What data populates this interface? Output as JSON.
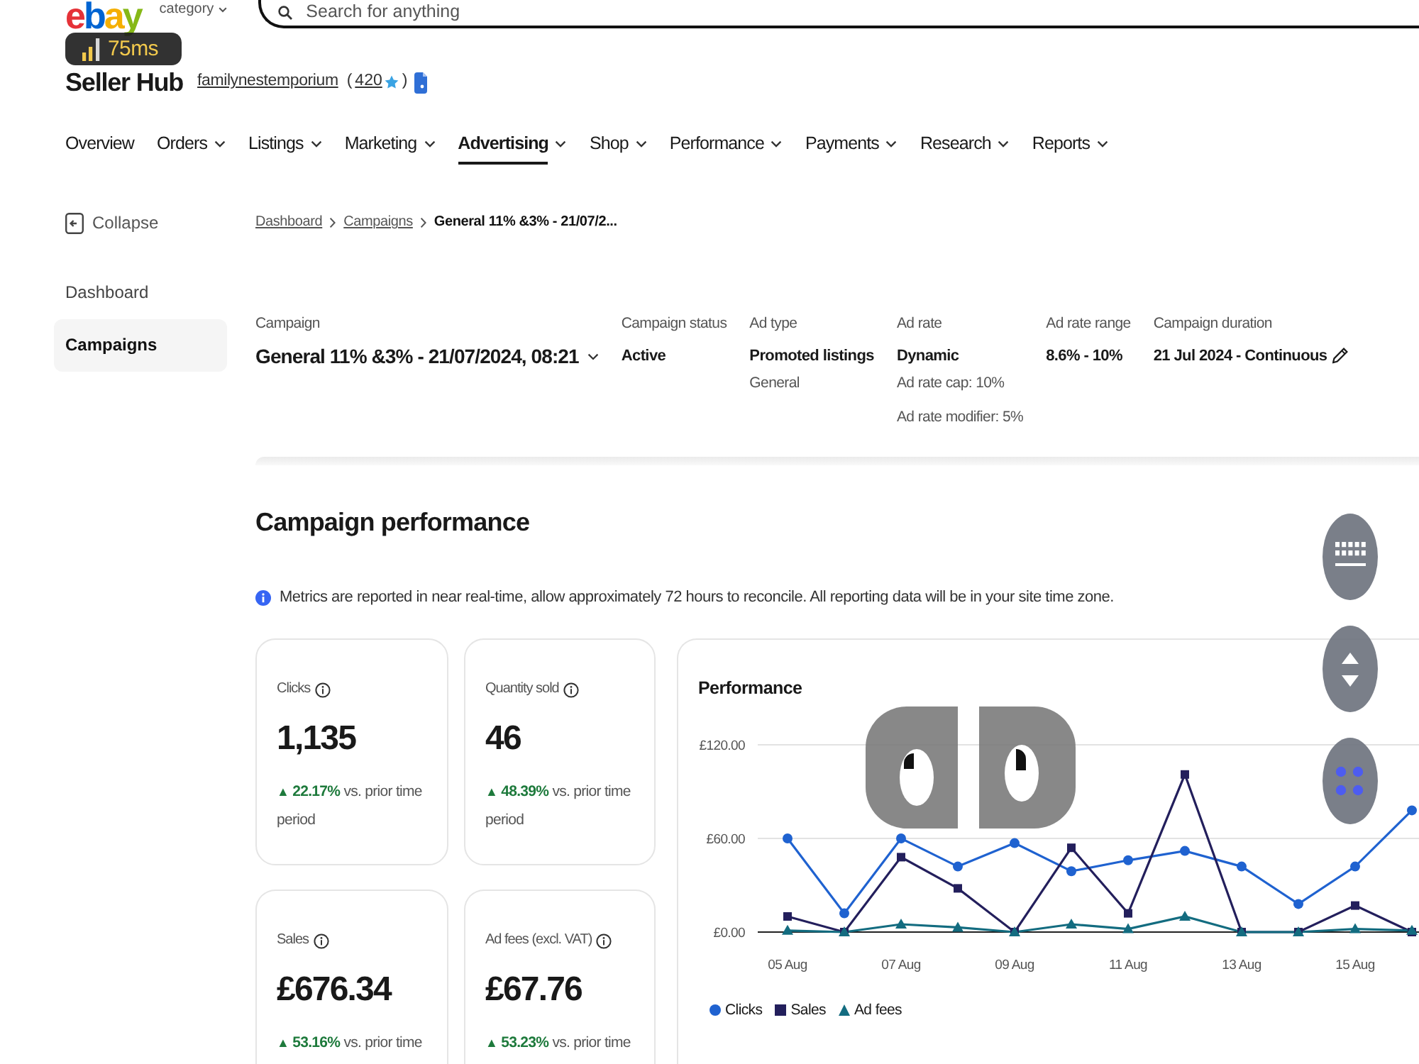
{
  "header": {
    "logo": "ebay",
    "category_label": "category",
    "search": {
      "placeholder": "Search for anything"
    }
  },
  "latency": {
    "reading": "75ms"
  },
  "seller": {
    "title": "Seller Hub",
    "name": "familynestemporium",
    "feedback_open": "(",
    "feedback_score": "420",
    "feedback_close": ")"
  },
  "nav": [
    {
      "label": "Overview",
      "dropdown": false,
      "selected": false
    },
    {
      "label": "Orders",
      "dropdown": true,
      "selected": false
    },
    {
      "label": "Listings",
      "dropdown": true,
      "selected": false
    },
    {
      "label": "Marketing",
      "dropdown": true,
      "selected": false
    },
    {
      "label": "Advertising",
      "dropdown": true,
      "selected": true
    },
    {
      "label": "Shop",
      "dropdown": true,
      "selected": false
    },
    {
      "label": "Performance",
      "dropdown": true,
      "selected": false
    },
    {
      "label": "Payments",
      "dropdown": true,
      "selected": false
    },
    {
      "label": "Research",
      "dropdown": true,
      "selected": false
    },
    {
      "label": "Reports",
      "dropdown": true,
      "selected": false
    }
  ],
  "sidebar": {
    "collapse": "Collapse",
    "items": [
      {
        "label": "Dashboard",
        "selected": false
      },
      {
        "label": "Campaigns",
        "selected": true
      }
    ]
  },
  "breadcrumb": [
    {
      "label": "Dashboard",
      "current": false
    },
    {
      "label": "Campaigns",
      "current": false
    },
    {
      "label": "General 11% &3% - 21/07/2...",
      "current": true
    }
  ],
  "campaign_fields": [
    {
      "kind": "select",
      "label": "Campaign",
      "value": "General 11% &3% - 21/07/2024, 08:21"
    },
    {
      "kind": "plain",
      "label": "Campaign status",
      "value": "Active"
    },
    {
      "kind": "plain",
      "label": "Ad type",
      "value": "Promoted listings",
      "notes": [
        "General"
      ]
    },
    {
      "kind": "plain",
      "label": "Ad rate",
      "value": "Dynamic",
      "notes": [
        "Ad rate cap: 10%",
        "Ad rate modifier: 5%"
      ]
    },
    {
      "kind": "plain",
      "label": "Ad rate range",
      "value": "8.6% - 10%"
    },
    {
      "kind": "editable",
      "label": "Campaign duration",
      "value": "21 Jul 2024 - Continuous"
    }
  ],
  "performance": {
    "title": "Campaign performance",
    "notice": "Metrics are reported in near real-time, allow approximately 72 hours to reconcile. All reporting data will be in your site time zone.",
    "metrics": [
      {
        "label": "Clicks",
        "value": "1,135",
        "sign": "▲",
        "change": "22.17%",
        "comparison": "vs. prior time period"
      },
      {
        "label": "Quantity sold",
        "value": "46",
        "sign": "▲",
        "change": "48.39%",
        "comparison": "vs. prior time period"
      },
      {
        "label": "Sales",
        "value": "£676.34",
        "sign": "▲",
        "change": "53.16%",
        "comparison": "vs. prior time"
      },
      {
        "label": "Ad fees (excl. VAT)",
        "value": "£67.76",
        "sign": "▲",
        "change": "53.23%",
        "comparison": "vs. prior time"
      }
    ],
    "chart": {
      "chart_data": {
        "type": "line",
        "title": "Performance",
        "categories": [
          "05 Aug",
          null,
          "07 Aug",
          null,
          "09 Aug",
          null,
          "11 Aug",
          null,
          "13 Aug",
          null,
          "15 Aug",
          null
        ],
        "ylim": [
          0,
          120
        ],
        "yticks": [
          {
            "value": 0,
            "label": "£0.00"
          },
          {
            "value": 60,
            "label": "£60.00"
          },
          {
            "value": 120,
            "label": "£120.00"
          }
        ],
        "series": [
          {
            "name": "Clicks",
            "color": "#1f62d0",
            "marker": "circle",
            "values": [
              60,
              12,
              60,
              42,
              57,
              39,
              46,
              52,
              42,
              18,
              42,
              78
            ]
          },
          {
            "name": "Sales",
            "color": "#231f5c",
            "marker": "square",
            "values": [
              10,
              0,
              48,
              28,
              0,
              54,
              12,
              101,
              0,
              0,
              17,
              0
            ]
          },
          {
            "name": "Ad fees",
            "color": "#136c80",
            "marker": "triangle",
            "values": [
              1,
              0,
              5,
              3,
              0,
              5,
              2,
              10,
              0,
              0,
              2,
              1
            ]
          }
        ]
      }
    }
  },
  "overlay": {
    "buttons": [
      {
        "kind": "keyboard"
      },
      {
        "kind": "scroll"
      },
      {
        "kind": "pad"
      }
    ],
    "mouse": [
      {
        "kind": "left"
      },
      {
        "kind": "right"
      }
    ]
  }
}
